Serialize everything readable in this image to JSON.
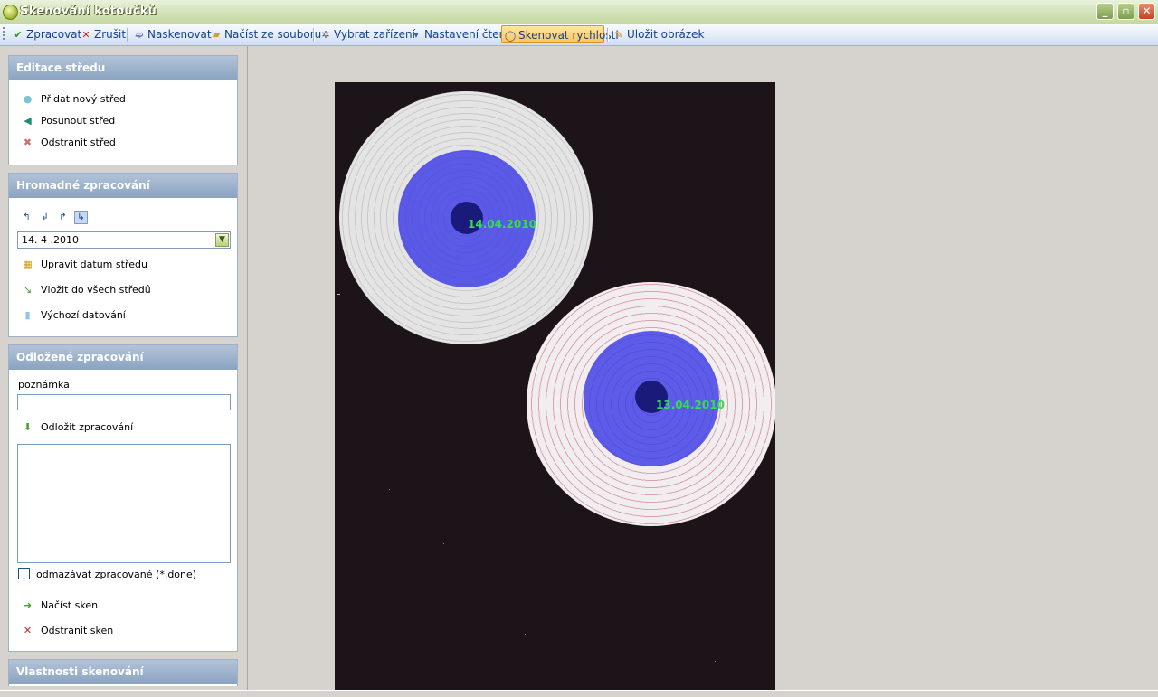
{
  "window": {
    "title": "Skenování kotoučků",
    "minimize": "_",
    "maximize": "▫",
    "close": "✕"
  },
  "toolbar": {
    "items": [
      {
        "label": "Zpracovat",
        "icon": "checkmark-icon"
      },
      {
        "label": "Zrušit",
        "icon": "cross-icon"
      },
      {
        "label": "Naskenovat",
        "icon": "scanner-icon"
      },
      {
        "label": "Načíst ze souboru",
        "icon": "folder-icon"
      },
      {
        "label": "Vybrat zařízení",
        "icon": "device-icon"
      },
      {
        "label": "Nastavení čtení",
        "icon": "settings-icon"
      },
      {
        "label": "Skenovat rychlosti",
        "icon": "disc-icon",
        "active": true
      },
      {
        "label": "Uložit obrázek",
        "icon": "save-icon"
      }
    ]
  },
  "sidebar": {
    "center_edit": {
      "title": "Editace středu",
      "items": [
        {
          "label": "Přidat nový střed",
          "icon": "add-center-icon"
        },
        {
          "label": "Posunout střed",
          "icon": "move-center-icon"
        },
        {
          "label": "Odstranit střed",
          "icon": "remove-center-icon"
        }
      ]
    },
    "bulk": {
      "title": "Hromadné zpracování",
      "date_value": "14. 4 .2010",
      "items": [
        {
          "label": "Upravit datum středu"
        },
        {
          "label": "Vložit do všech středů"
        },
        {
          "label": "Výchozí datování"
        }
      ]
    },
    "deferred": {
      "title": "Odložené zpracování",
      "note_label": "poznámka",
      "note_value": "",
      "defer_label": "Odložit zpracování",
      "delete_done_label": "odmazávat zpracované (*.done)",
      "load_scan_label": "Načíst sken",
      "remove_scan_label": "Odstranit sken"
    },
    "scan_props": {
      "title": "Vlastnosti skenování"
    }
  },
  "scan": {
    "disc1_date": "14.04.2010",
    "disc2_date": "13.04.2010",
    "colors": {
      "center_overlay": "#3c3ce6",
      "date_text": "#2fe04a",
      "background": "#1c1418"
    }
  }
}
